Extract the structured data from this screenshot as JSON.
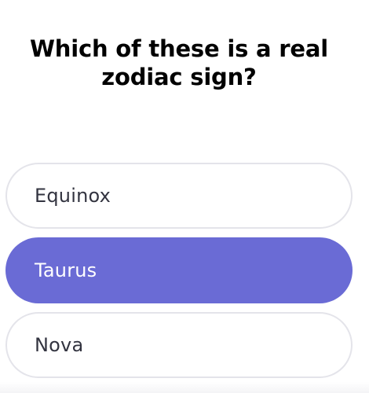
{
  "quiz": {
    "question": "Which of these is a real zodiac sign?",
    "options": [
      {
        "label": "Equinox",
        "selected": false
      },
      {
        "label": "Taurus",
        "selected": true
      },
      {
        "label": "Nova",
        "selected": false
      }
    ]
  },
  "colors": {
    "selected_fill": "#6a6bd5",
    "option_border": "#e4e4ea",
    "option_text": "#333440",
    "question_text": "#000000"
  }
}
